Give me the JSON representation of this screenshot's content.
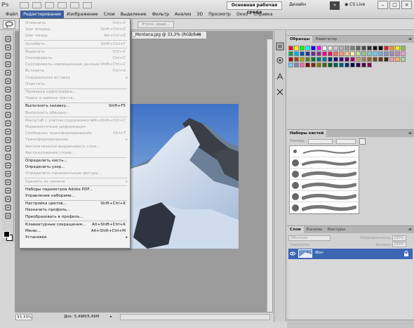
{
  "app": {
    "logo": "Ps"
  },
  "menubar": {
    "items": [
      "Файл",
      "Редактирование",
      "Изображение",
      "Слои",
      "Выделение",
      "Фильтр",
      "Анализ",
      "3D",
      "Просмотр",
      "Окно",
      "Справка"
    ],
    "active_index": 1,
    "workspace": "Основная рабочая среда",
    "design": "Дизайн",
    "more": "»",
    "cslive": "CS Live",
    "win_min": "–",
    "win_max": "□",
    "win_close": "×"
  },
  "options": {
    "refine_edge": "Уточн. край..."
  },
  "document": {
    "tab_title": "_Montana.jpg @ 33,3% (RGB/8#)",
    "close": "×",
    "zoom": "33,33%",
    "info": "Док: 5,49M/5,49M",
    "status_arrow": "▸"
  },
  "edit_menu": {
    "items": [
      {
        "label": "Отменить",
        "shortcut": "Ctrl+Z",
        "enabled": false
      },
      {
        "label": "Шаг вперед",
        "shortcut": "Shift+Ctrl+Z",
        "enabled": false
      },
      {
        "label": "Шаг назад",
        "shortcut": "Alt+Ctrl+Z",
        "enabled": false
      },
      {
        "label": "Ослабить...",
        "shortcut": "Shift+Ctrl+F",
        "enabled": false
      },
      {
        "label": "Вырезать",
        "shortcut": "Ctrl+X",
        "enabled": false
      },
      {
        "label": "Скопировать",
        "shortcut": "Ctrl+C",
        "enabled": false
      },
      {
        "label": "Скопировать совмещенные данные",
        "shortcut": "Shift+Ctrl+C",
        "enabled": false
      },
      {
        "label": "Вставить",
        "shortcut": "Ctrl+V",
        "enabled": false
      },
      {
        "label": "Специальная вставка",
        "shortcut": "",
        "enabled": false,
        "submenu": true
      },
      {
        "label": "Очистить",
        "shortcut": "",
        "enabled": false
      },
      {
        "label": "Проверка орфографии...",
        "shortcut": "",
        "enabled": false
      },
      {
        "label": "Поиск и замена текста...",
        "shortcut": "",
        "enabled": false
      },
      {
        "label": "Выполнить заливку...",
        "shortcut": "Shift+F5",
        "enabled": true
      },
      {
        "label": "Выполнить обводку...",
        "shortcut": "",
        "enabled": false
      },
      {
        "label": "Масштаб с учетом содержимого",
        "shortcut": "Alt+Shift+Ctrl+C",
        "enabled": false
      },
      {
        "label": "Марионеточная деформация",
        "shortcut": "",
        "enabled": false
      },
      {
        "label": "Свободное трансформирование",
        "shortcut": "Ctrl+T",
        "enabled": false
      },
      {
        "label": "Трансформирование",
        "shortcut": "",
        "enabled": false,
        "submenu": true
      },
      {
        "label": "Автоматически выравнивать слои...",
        "shortcut": "",
        "enabled": false
      },
      {
        "label": "Автоналожение слоев...",
        "shortcut": "",
        "enabled": false
      },
      {
        "label": "Определить кисть...",
        "shortcut": "",
        "enabled": true
      },
      {
        "label": "Определить узор...",
        "shortcut": "",
        "enabled": true
      },
      {
        "label": "Определить произвольную фигуру...",
        "shortcut": "",
        "enabled": false
      },
      {
        "label": "Удалить из памяти",
        "shortcut": "",
        "enabled": false,
        "submenu": true
      },
      {
        "label": "Наборы параметров Adobe PDF...",
        "shortcut": "",
        "enabled": true
      },
      {
        "label": "Управление наборами...",
        "shortcut": "",
        "enabled": true
      },
      {
        "label": "Настройка цветов...",
        "shortcut": "Shift+Ctrl+K",
        "enabled": true
      },
      {
        "label": "Назначить профиль...",
        "shortcut": "",
        "enabled": true
      },
      {
        "label": "Преобразовать в профиль...",
        "shortcut": "",
        "enabled": true
      },
      {
        "label": "Клавиатурные сокращения...",
        "shortcut": "Alt+Shift+Ctrl+K",
        "enabled": true
      },
      {
        "label": "Меню...",
        "shortcut": "Alt+Shift+Ctrl+M",
        "enabled": true
      },
      {
        "label": "Установки",
        "shortcut": "",
        "enabled": true,
        "submenu": true
      }
    ]
  },
  "swatches_panel": {
    "tabs": [
      "Образцы",
      "Навигатор"
    ],
    "menu": "≡",
    "colors": [
      "#ff0000",
      "#ffff00",
      "#00ff00",
      "#00ffff",
      "#0000ff",
      "#ff00ff",
      "#ffffff",
      "#e6e6e6",
      "#cccccc",
      "#b3b3b3",
      "#999999",
      "#808080",
      "#666666",
      "#4d4d4d",
      "#333333",
      "#1a1a1a",
      "#000000",
      "#ed1c24",
      "#f7941d",
      "#fff200",
      "#8dc63f",
      "#00a651",
      "#00aeef",
      "#0054a6",
      "#2e3192",
      "#662d91",
      "#92278f",
      "#ec008c",
      "#ed145b",
      "#f26c4f",
      "#f69679",
      "#fdc689",
      "#fff799",
      "#c4df9b",
      "#82ca9c",
      "#7accc8",
      "#6dcff6",
      "#7da7d9",
      "#8493ca",
      "#a186be",
      "#bd8cbf",
      "#f49ac1",
      "#9e0b0f",
      "#a0410d",
      "#aba000",
      "#598527",
      "#007236",
      "#00746b",
      "#0076a3",
      "#003471",
      "#1b1464",
      "#440e62",
      "#630460",
      "#9e005d",
      "#c69c6d",
      "#a67c52",
      "#8c6239",
      "#754c24",
      "#603913",
      "#3c2415",
      "#f5989d",
      "#fbaf5d",
      "#a3d39c",
      "#6ecff6",
      "#8781bd",
      "#f06eaa",
      "#790000",
      "#7b2e00",
      "#827b00",
      "#406618",
      "#005e20",
      "#005952",
      "#005b7f",
      "#003663",
      "#0d004c",
      "#32004b",
      "#4b0049",
      "#7b0046"
    ]
  },
  "brushes_panel": {
    "tabs": [
      "Наборы кистей"
    ],
    "menu": "≡",
    "size_label": "Размер"
  },
  "layers_panel": {
    "tabs": [
      "Слои",
      "Каналы",
      "Контуры"
    ],
    "menu": "≡",
    "blend_mode": "Обычные",
    "opacity_label": "Непрозрачность:",
    "opacity_value": "100%",
    "lock_label": "Закрепить:",
    "fill_label": "Заливка:",
    "fill_value": "100%",
    "layer_name": "Фон",
    "eye": "👁",
    "lock": "🔒"
  }
}
